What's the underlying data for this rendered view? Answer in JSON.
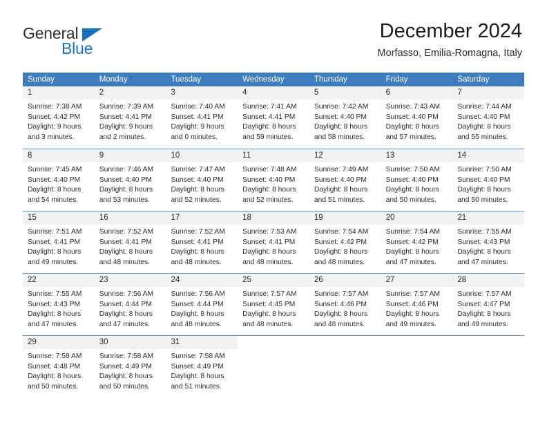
{
  "logo": {
    "word_one": "General",
    "word_two": "Blue",
    "triangle_color": "#1571c4"
  },
  "header": {
    "title": "December 2024",
    "location": "Morfasso, Emilia-Romagna, Italy"
  },
  "theme": {
    "header_bar": "#3d7dbf",
    "daynum_band": "#f2f2f2",
    "row_divider": "#5b93cc"
  },
  "weekdays": [
    "Sunday",
    "Monday",
    "Tuesday",
    "Wednesday",
    "Thursday",
    "Friday",
    "Saturday"
  ],
  "weeks": [
    [
      {
        "day": "1",
        "sunrise": "Sunrise: 7:38 AM",
        "sunset": "Sunset: 4:42 PM",
        "daylight_1": "Daylight: 9 hours",
        "daylight_2": "and 3 minutes."
      },
      {
        "day": "2",
        "sunrise": "Sunrise: 7:39 AM",
        "sunset": "Sunset: 4:41 PM",
        "daylight_1": "Daylight: 9 hours",
        "daylight_2": "and 2 minutes."
      },
      {
        "day": "3",
        "sunrise": "Sunrise: 7:40 AM",
        "sunset": "Sunset: 4:41 PM",
        "daylight_1": "Daylight: 9 hours",
        "daylight_2": "and 0 minutes."
      },
      {
        "day": "4",
        "sunrise": "Sunrise: 7:41 AM",
        "sunset": "Sunset: 4:41 PM",
        "daylight_1": "Daylight: 8 hours",
        "daylight_2": "and 59 minutes."
      },
      {
        "day": "5",
        "sunrise": "Sunrise: 7:42 AM",
        "sunset": "Sunset: 4:40 PM",
        "daylight_1": "Daylight: 8 hours",
        "daylight_2": "and 58 minutes."
      },
      {
        "day": "6",
        "sunrise": "Sunrise: 7:43 AM",
        "sunset": "Sunset: 4:40 PM",
        "daylight_1": "Daylight: 8 hours",
        "daylight_2": "and 57 minutes."
      },
      {
        "day": "7",
        "sunrise": "Sunrise: 7:44 AM",
        "sunset": "Sunset: 4:40 PM",
        "daylight_1": "Daylight: 8 hours",
        "daylight_2": "and 55 minutes."
      }
    ],
    [
      {
        "day": "8",
        "sunrise": "Sunrise: 7:45 AM",
        "sunset": "Sunset: 4:40 PM",
        "daylight_1": "Daylight: 8 hours",
        "daylight_2": "and 54 minutes."
      },
      {
        "day": "9",
        "sunrise": "Sunrise: 7:46 AM",
        "sunset": "Sunset: 4:40 PM",
        "daylight_1": "Daylight: 8 hours",
        "daylight_2": "and 53 minutes."
      },
      {
        "day": "10",
        "sunrise": "Sunrise: 7:47 AM",
        "sunset": "Sunset: 4:40 PM",
        "daylight_1": "Daylight: 8 hours",
        "daylight_2": "and 52 minutes."
      },
      {
        "day": "11",
        "sunrise": "Sunrise: 7:48 AM",
        "sunset": "Sunset: 4:40 PM",
        "daylight_1": "Daylight: 8 hours",
        "daylight_2": "and 52 minutes."
      },
      {
        "day": "12",
        "sunrise": "Sunrise: 7:49 AM",
        "sunset": "Sunset: 4:40 PM",
        "daylight_1": "Daylight: 8 hours",
        "daylight_2": "and 51 minutes."
      },
      {
        "day": "13",
        "sunrise": "Sunrise: 7:50 AM",
        "sunset": "Sunset: 4:40 PM",
        "daylight_1": "Daylight: 8 hours",
        "daylight_2": "and 50 minutes."
      },
      {
        "day": "14",
        "sunrise": "Sunrise: 7:50 AM",
        "sunset": "Sunset: 4:40 PM",
        "daylight_1": "Daylight: 8 hours",
        "daylight_2": "and 50 minutes."
      }
    ],
    [
      {
        "day": "15",
        "sunrise": "Sunrise: 7:51 AM",
        "sunset": "Sunset: 4:41 PM",
        "daylight_1": "Daylight: 8 hours",
        "daylight_2": "and 49 minutes."
      },
      {
        "day": "16",
        "sunrise": "Sunrise: 7:52 AM",
        "sunset": "Sunset: 4:41 PM",
        "daylight_1": "Daylight: 8 hours",
        "daylight_2": "and 48 minutes."
      },
      {
        "day": "17",
        "sunrise": "Sunrise: 7:52 AM",
        "sunset": "Sunset: 4:41 PM",
        "daylight_1": "Daylight: 8 hours",
        "daylight_2": "and 48 minutes."
      },
      {
        "day": "18",
        "sunrise": "Sunrise: 7:53 AM",
        "sunset": "Sunset: 4:41 PM",
        "daylight_1": "Daylight: 8 hours",
        "daylight_2": "and 48 minutes."
      },
      {
        "day": "19",
        "sunrise": "Sunrise: 7:54 AM",
        "sunset": "Sunset: 4:42 PM",
        "daylight_1": "Daylight: 8 hours",
        "daylight_2": "and 48 minutes."
      },
      {
        "day": "20",
        "sunrise": "Sunrise: 7:54 AM",
        "sunset": "Sunset: 4:42 PM",
        "daylight_1": "Daylight: 8 hours",
        "daylight_2": "and 47 minutes."
      },
      {
        "day": "21",
        "sunrise": "Sunrise: 7:55 AM",
        "sunset": "Sunset: 4:43 PM",
        "daylight_1": "Daylight: 8 hours",
        "daylight_2": "and 47 minutes."
      }
    ],
    [
      {
        "day": "22",
        "sunrise": "Sunrise: 7:55 AM",
        "sunset": "Sunset: 4:43 PM",
        "daylight_1": "Daylight: 8 hours",
        "daylight_2": "and 47 minutes."
      },
      {
        "day": "23",
        "sunrise": "Sunrise: 7:56 AM",
        "sunset": "Sunset: 4:44 PM",
        "daylight_1": "Daylight: 8 hours",
        "daylight_2": "and 47 minutes."
      },
      {
        "day": "24",
        "sunrise": "Sunrise: 7:56 AM",
        "sunset": "Sunset: 4:44 PM",
        "daylight_1": "Daylight: 8 hours",
        "daylight_2": "and 48 minutes."
      },
      {
        "day": "25",
        "sunrise": "Sunrise: 7:57 AM",
        "sunset": "Sunset: 4:45 PM",
        "daylight_1": "Daylight: 8 hours",
        "daylight_2": "and 48 minutes."
      },
      {
        "day": "26",
        "sunrise": "Sunrise: 7:57 AM",
        "sunset": "Sunset: 4:46 PM",
        "daylight_1": "Daylight: 8 hours",
        "daylight_2": "and 48 minutes."
      },
      {
        "day": "27",
        "sunrise": "Sunrise: 7:57 AM",
        "sunset": "Sunset: 4:46 PM",
        "daylight_1": "Daylight: 8 hours",
        "daylight_2": "and 49 minutes."
      },
      {
        "day": "28",
        "sunrise": "Sunrise: 7:57 AM",
        "sunset": "Sunset: 4:47 PM",
        "daylight_1": "Daylight: 8 hours",
        "daylight_2": "and 49 minutes."
      }
    ],
    [
      {
        "day": "29",
        "sunrise": "Sunrise: 7:58 AM",
        "sunset": "Sunset: 4:48 PM",
        "daylight_1": "Daylight: 8 hours",
        "daylight_2": "and 50 minutes."
      },
      {
        "day": "30",
        "sunrise": "Sunrise: 7:58 AM",
        "sunset": "Sunset: 4:49 PM",
        "daylight_1": "Daylight: 8 hours",
        "daylight_2": "and 50 minutes."
      },
      {
        "day": "31",
        "sunrise": "Sunrise: 7:58 AM",
        "sunset": "Sunset: 4:49 PM",
        "daylight_1": "Daylight: 8 hours",
        "daylight_2": "and 51 minutes."
      },
      {
        "day": "",
        "sunrise": "",
        "sunset": "",
        "daylight_1": "",
        "daylight_2": ""
      },
      {
        "day": "",
        "sunrise": "",
        "sunset": "",
        "daylight_1": "",
        "daylight_2": ""
      },
      {
        "day": "",
        "sunrise": "",
        "sunset": "",
        "daylight_1": "",
        "daylight_2": ""
      },
      {
        "day": "",
        "sunrise": "",
        "sunset": "",
        "daylight_1": "",
        "daylight_2": ""
      }
    ]
  ]
}
